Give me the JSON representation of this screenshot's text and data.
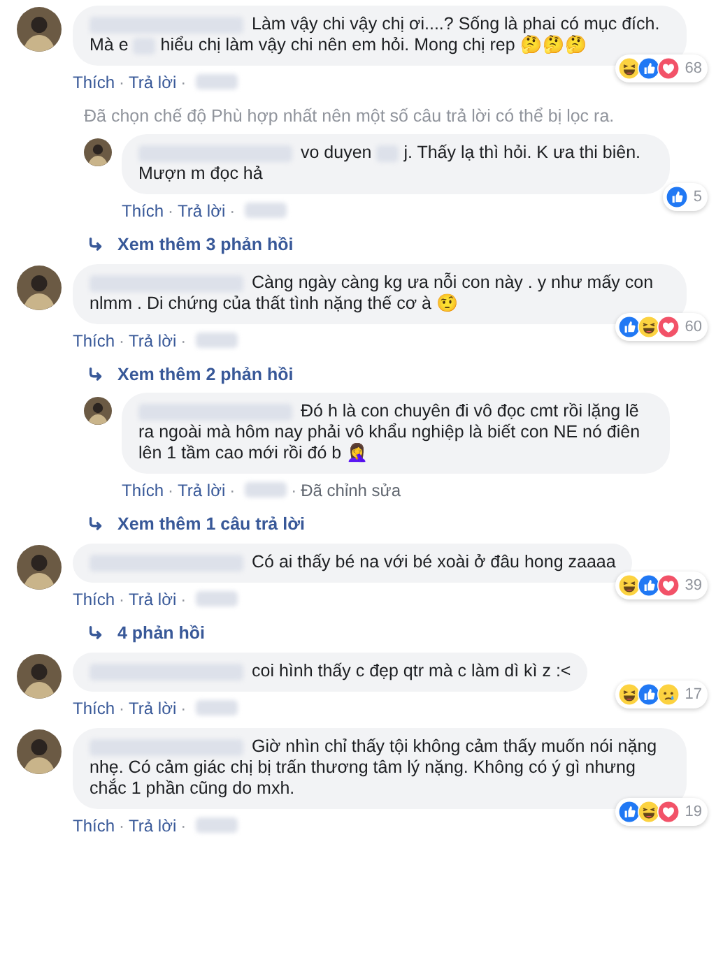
{
  "comments": [
    {
      "kind": "comment",
      "text": [
        {
          "kind": "blur"
        },
        {
          "kind": "text",
          "text": "Làm vậy chi vậy chị ơi....? Sống là phai có mục đích. Mà e "
        },
        {
          "kind": "word-blur"
        },
        {
          "kind": "text",
          "text": " hiểu chị làm vậy chi nên em hỏi. Mong chị rep 🤔🤔🤔"
        }
      ],
      "meta": [
        {
          "kind": "link",
          "text": "Thích"
        },
        {
          "kind": "sep",
          "text": "·"
        },
        {
          "kind": "link",
          "text": "Trả lời"
        },
        {
          "kind": "sep",
          "text": "·"
        },
        {
          "kind": "blur"
        }
      ],
      "reactions": {
        "icons": [
          {
            "kind": "haha"
          },
          {
            "kind": "like"
          },
          {
            "kind": "love"
          }
        ],
        "count": "68"
      },
      "children": [
        {
          "kind": "notice",
          "text": "Đã chọn chế độ Phù hợp nhất nên một số câu trả lời có thể bị lọc ra."
        },
        {
          "kind": "comment",
          "text": [
            {
              "kind": "blur"
            },
            {
              "kind": "text",
              "text": "vo duyen "
            },
            {
              "kind": "word-blur"
            },
            {
              "kind": "text",
              "text": " j. Thấy lạ thì hỏi. K ưa thi biên. Mượn m đọc hả"
            }
          ],
          "meta": [
            {
              "kind": "link",
              "text": "Thích"
            },
            {
              "kind": "sep",
              "text": "·"
            },
            {
              "kind": "link",
              "text": "Trả lời"
            },
            {
              "kind": "sep",
              "text": "·"
            },
            {
              "kind": "blur"
            }
          ],
          "reactions": {
            "icons": [
              {
                "kind": "like"
              }
            ],
            "count": "5"
          }
        },
        {
          "kind": "more",
          "text": "Xem thêm 3 phản hồi"
        }
      ]
    },
    {
      "kind": "comment",
      "text": [
        {
          "kind": "blur"
        },
        {
          "kind": "text",
          "text": "Càng ngày càng kg ưa nỗi con này . y như mấy con nlmm . Di chứng của thất tình nặng thế cơ à 🤨"
        }
      ],
      "meta": [
        {
          "kind": "link",
          "text": "Thích"
        },
        {
          "kind": "sep",
          "text": "·"
        },
        {
          "kind": "link",
          "text": "Trả lời"
        },
        {
          "kind": "sep",
          "text": "·"
        },
        {
          "kind": "blur"
        }
      ],
      "reactions": {
        "icons": [
          {
            "kind": "like"
          },
          {
            "kind": "haha"
          },
          {
            "kind": "love"
          }
        ],
        "count": "60"
      },
      "children": [
        {
          "kind": "more",
          "text": "Xem thêm 2 phản hồi"
        },
        {
          "kind": "comment",
          "text": [
            {
              "kind": "blur"
            },
            {
              "kind": "text",
              "text": "Đó h là con chuyên đi vô đọc cmt rồi lặng lẽ ra ngoài mà hôm nay phải vô khẩu nghiệp là biết con NE nó điên lên 1 tầm cao mới rồi đó b 🤦‍♀️"
            }
          ],
          "meta": [
            {
              "kind": "link",
              "text": "Thích"
            },
            {
              "kind": "sep",
              "text": "·"
            },
            {
              "kind": "link",
              "text": "Trả lời"
            },
            {
              "kind": "sep",
              "text": "·"
            },
            {
              "kind": "blur"
            },
            {
              "kind": "sep",
              "text": "·"
            },
            {
              "kind": "note",
              "text": "Đã chỉnh sửa"
            }
          ]
        },
        {
          "kind": "more",
          "text": "Xem thêm 1 câu trả lời"
        }
      ]
    },
    {
      "kind": "comment",
      "text": [
        {
          "kind": "blur"
        },
        {
          "kind": "text",
          "text": "Có ai thấy bé na với bé xoài ở đâu hong zaaaa"
        }
      ],
      "meta": [
        {
          "kind": "link",
          "text": "Thích"
        },
        {
          "kind": "sep",
          "text": "·"
        },
        {
          "kind": "link",
          "text": "Trả lời"
        },
        {
          "kind": "sep",
          "text": "·"
        },
        {
          "kind": "blur"
        }
      ],
      "reactions": {
        "icons": [
          {
            "kind": "haha"
          },
          {
            "kind": "like"
          },
          {
            "kind": "love"
          }
        ],
        "count": "39"
      },
      "children": [
        {
          "kind": "more",
          "text": "4 phản hồi"
        }
      ]
    },
    {
      "kind": "comment",
      "text": [
        {
          "kind": "blur"
        },
        {
          "kind": "text",
          "text": "coi hình thấy c đẹp qtr mà c làm dì kì z :<"
        }
      ],
      "meta": [
        {
          "kind": "link",
          "text": "Thích"
        },
        {
          "kind": "sep",
          "text": "·"
        },
        {
          "kind": "link",
          "text": "Trả lời"
        },
        {
          "kind": "sep",
          "text": "·"
        },
        {
          "kind": "blur"
        }
      ],
      "reactions": {
        "icons": [
          {
            "kind": "haha"
          },
          {
            "kind": "like"
          },
          {
            "kind": "sad"
          }
        ],
        "count": "17"
      }
    },
    {
      "kind": "comment",
      "text": [
        {
          "kind": "blur"
        },
        {
          "kind": "text",
          "text": "Giờ nhìn chỉ thấy tội không cảm thấy muốn nói nặng nhẹ. Có cảm giác chị bị trấn thương tâm lý nặng. Không có ý gì nhưng chắc 1 phần cũng do mxh."
        }
      ],
      "meta": [
        {
          "kind": "link",
          "text": "Thích"
        },
        {
          "kind": "sep",
          "text": "·"
        },
        {
          "kind": "link",
          "text": "Trả lời"
        },
        {
          "kind": "sep",
          "text": "·"
        },
        {
          "kind": "blur"
        }
      ],
      "reactions": {
        "icons": [
          {
            "kind": "like"
          },
          {
            "kind": "haha"
          },
          {
            "kind": "love"
          }
        ],
        "count": "19"
      }
    }
  ]
}
